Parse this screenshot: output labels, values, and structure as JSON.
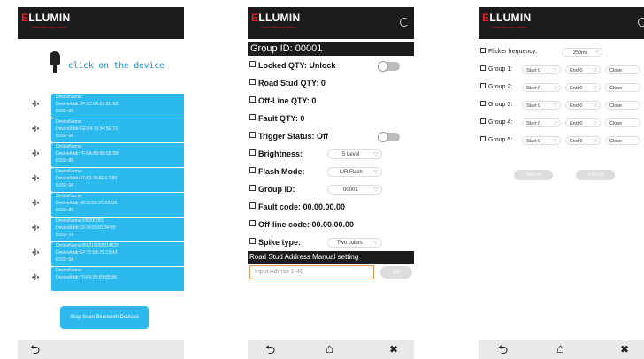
{
  "logo": {
    "word_prefix": "E",
    "word_rest": "LLUMIN",
    "tagline": "Cloud Warning System"
  },
  "screen1": {
    "hint": "click on the device",
    "bt_icon_glyph": "•ᛒ•",
    "devices": [
      {
        "name": "DeviceName:",
        "addr": "DeviceAddr:6F:5C:0A:81:5D:B8",
        "rssi": "RSSI:-99"
      },
      {
        "name": "DeviceName:",
        "addr": "DeviceAddr:EE:B4:71:94:5E:72",
        "rssi": "RSSI:-96"
      },
      {
        "name": "DeviceName:",
        "addr": "DeviceAddr:7F:FA:A9:0B:5E:D8",
        "rssi": "RSSI:-85"
      },
      {
        "name": "DeviceName:",
        "addr": "DeviceAddr:47:A2:76:8E:E7:89",
        "rssi": "RSSI:-96"
      },
      {
        "name": "DeviceName:",
        "addr": "DeviceAddr:48:56:56:2C:60:D8",
        "rssi": "RSSI:-85"
      },
      {
        "name": "DeviceName:XBD00001",
        "addr": "DeviceAddr:23:34:50:81:84:89",
        "rssi": "RSSI:-78"
      },
      {
        "name": "DeviceName:Bt6215058914828",
        "addr": "DeviceAddr:EF:72:5B:7E:15:43",
        "rssi": "RSSI:-94"
      },
      {
        "name": "DeviceName:",
        "addr": "DeviceAddr:70:F9:1B:8Y:85:B6",
        "rssi": ""
      }
    ],
    "stop_label": "Stop Scan Bluetooth Devices"
  },
  "screen2": {
    "group_title": "Group ID: 00001",
    "locked": "Locked QTY: Unlock",
    "road_stud": "Road Stud QTY: 0",
    "offline_qty": "Off-Line QTY: 0",
    "fault_qty": "Fault QTY: 0",
    "trigger": "Trigger Status:  Off",
    "brightness_label": "Brightness:",
    "brightness_value": "5 Level",
    "flash_label": "Flash Mode:",
    "flash_value": "L/R Flash",
    "groupid_label": "Group ID:",
    "groupid_value": "00001",
    "fault_code": "Fault code: 00.00.00.00",
    "offline_code": "Off-line code: 00.00.00.00",
    "spike_label": "Spike type:",
    "spike_value": "Two colors",
    "manual_title": "Road Stud Address Manual setting",
    "address_placeholder": "Input Adress 1-40",
    "set_label": "Set"
  },
  "screen3": {
    "flicker_label": "Flicker frequency:",
    "flicker_value": "250ms",
    "groups": [
      {
        "label": "Group 1:",
        "start": "Start 0",
        "end": "End 0",
        "state": "Close"
      },
      {
        "label": "Group 2:",
        "start": "Start 0",
        "end": "End 0",
        "state": "Close"
      },
      {
        "label": "Group 3:",
        "start": "Start 0",
        "end": "End 0",
        "state": "Close"
      },
      {
        "label": "Group 4:",
        "start": "Start 0",
        "end": "End 0",
        "state": "Close"
      },
      {
        "label": "Group 5:",
        "start": "Start 0",
        "end": "End 0",
        "state": "Close"
      }
    ],
    "turn_on": "Turn on",
    "turn_off": "Turn off"
  },
  "nav": {
    "back_glyph": "⮌",
    "home_glyph": "⌂",
    "tools_glyph": "✖"
  },
  "colors": {
    "accent": "#2cb9ee",
    "header": "#1c1c1c",
    "logo_red": "#e01f26",
    "hint_blue": "#1591d6"
  }
}
